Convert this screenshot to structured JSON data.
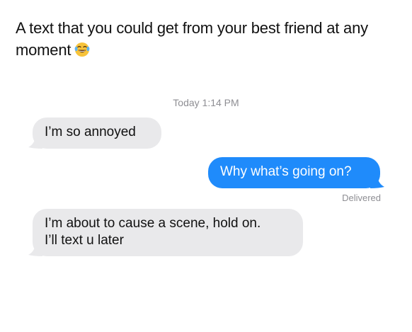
{
  "caption": "A text that you could get from your best friend at any moment",
  "caption_emoji": "tears-of-joy-emoji",
  "timestamp": "Today 1:14 PM",
  "messages": [
    {
      "direction": "received",
      "lines": [
        "I’m so annoyed"
      ]
    },
    {
      "direction": "sent",
      "lines": [
        "Why what’s going on?"
      ]
    },
    {
      "direction": "received",
      "lines": [
        "I’m about to cause a scene, hold on.",
        "I’ll text u later"
      ]
    }
  ],
  "delivery_status": "Delivered",
  "colors": {
    "sent_bubble": "#1f8bfb",
    "received_bubble": "#e9e9eb",
    "meta_text": "#8e8e93"
  }
}
